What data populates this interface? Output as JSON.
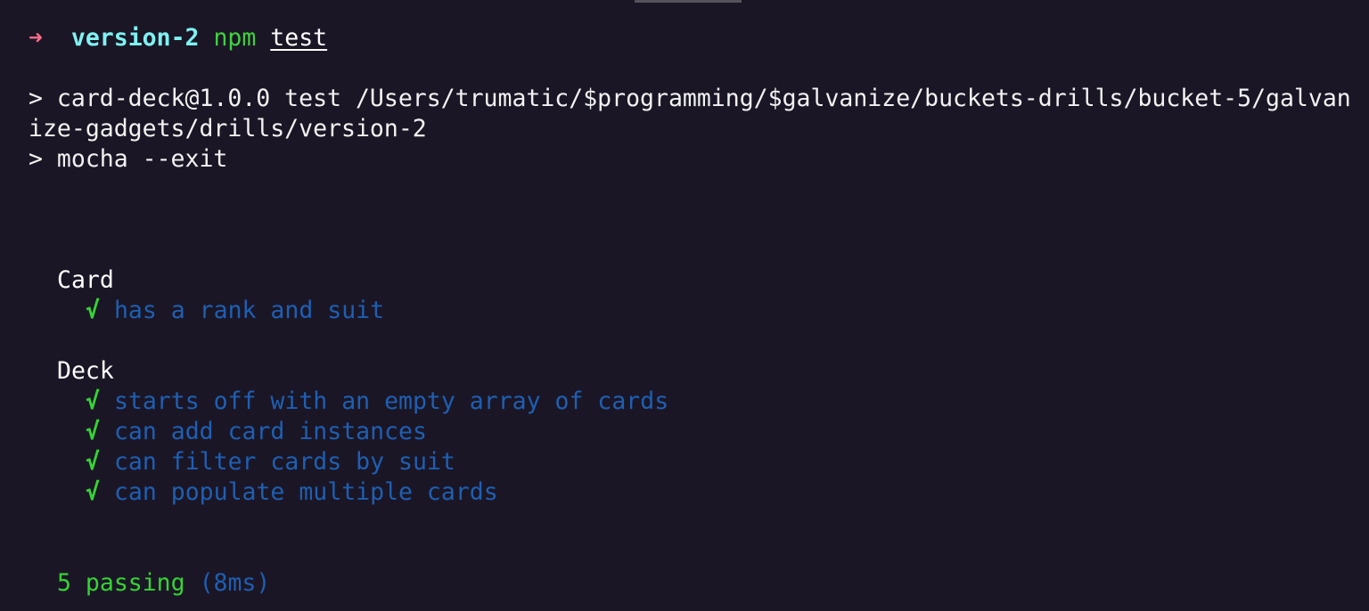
{
  "prompt": {
    "arrow": "➜",
    "directory": "version-2",
    "command": "npm",
    "argument": "test"
  },
  "output": {
    "script_line_1": "> card-deck@1.0.0 test /Users/trumatic/$programming/$galvanize/buckets-drills/bucket-5/galvan",
    "script_line_2": "ize-gadgets/drills/version-2",
    "script_line_3": "> mocha --exit"
  },
  "suites": [
    {
      "name": "Card",
      "tests": [
        {
          "check": "√",
          "title": "has a rank and suit"
        }
      ]
    },
    {
      "name": "Deck",
      "tests": [
        {
          "check": "√",
          "title": "starts off with an empty array of cards"
        },
        {
          "check": "√",
          "title": "can add card instances"
        },
        {
          "check": "√",
          "title": "can filter cards by suit"
        },
        {
          "check": "√",
          "title": "can populate multiple cards"
        }
      ]
    }
  ],
  "summary": {
    "passing": "5 passing",
    "duration": "(8ms)"
  },
  "colors": {
    "background": "#1b1625",
    "arrow": "#ff6b8b",
    "directory": "#7ff2f2",
    "command": "#3fd23f",
    "test_title": "#1e5fb3",
    "check": "#35d335"
  }
}
